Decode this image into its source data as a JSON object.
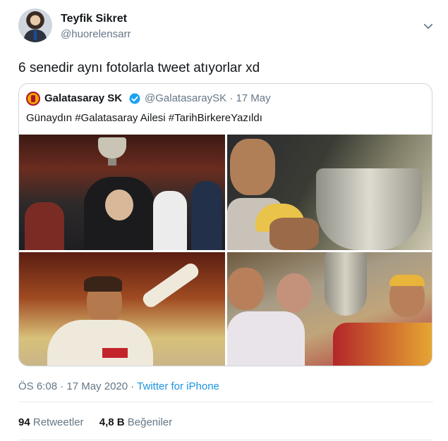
{
  "author": {
    "display_name": "Teyfik Sikret",
    "username": "@huorelensarr"
  },
  "tweet": {
    "text": "6 senedir aynı fotolarla tweet atıyorlar xd",
    "timestamp": "ÖS 6:08 · 17 May 2020 · ",
    "source": "Twitter for iPhone"
  },
  "quoted": {
    "name": "Galatasaray SK",
    "handle_date": "@GalatasaraySK · 17 May",
    "text": "Günaydın #Galatasaray Ailesi #TarihBirkereYazıldı"
  },
  "stats": {
    "retweets_count": "94",
    "retweets_label": "Retweetler",
    "likes_count": "4,8 B",
    "likes_label": "Beğeniler"
  },
  "colors": {
    "link": "#1b95e0",
    "secondary_text": "#657786",
    "border": "#ccd6dd",
    "club_red": "#a8142e",
    "club_yellow": "#f5a300"
  },
  "icons": [
    "chevron-down-icon",
    "verified-badge-icon",
    "club-logo-icon"
  ]
}
